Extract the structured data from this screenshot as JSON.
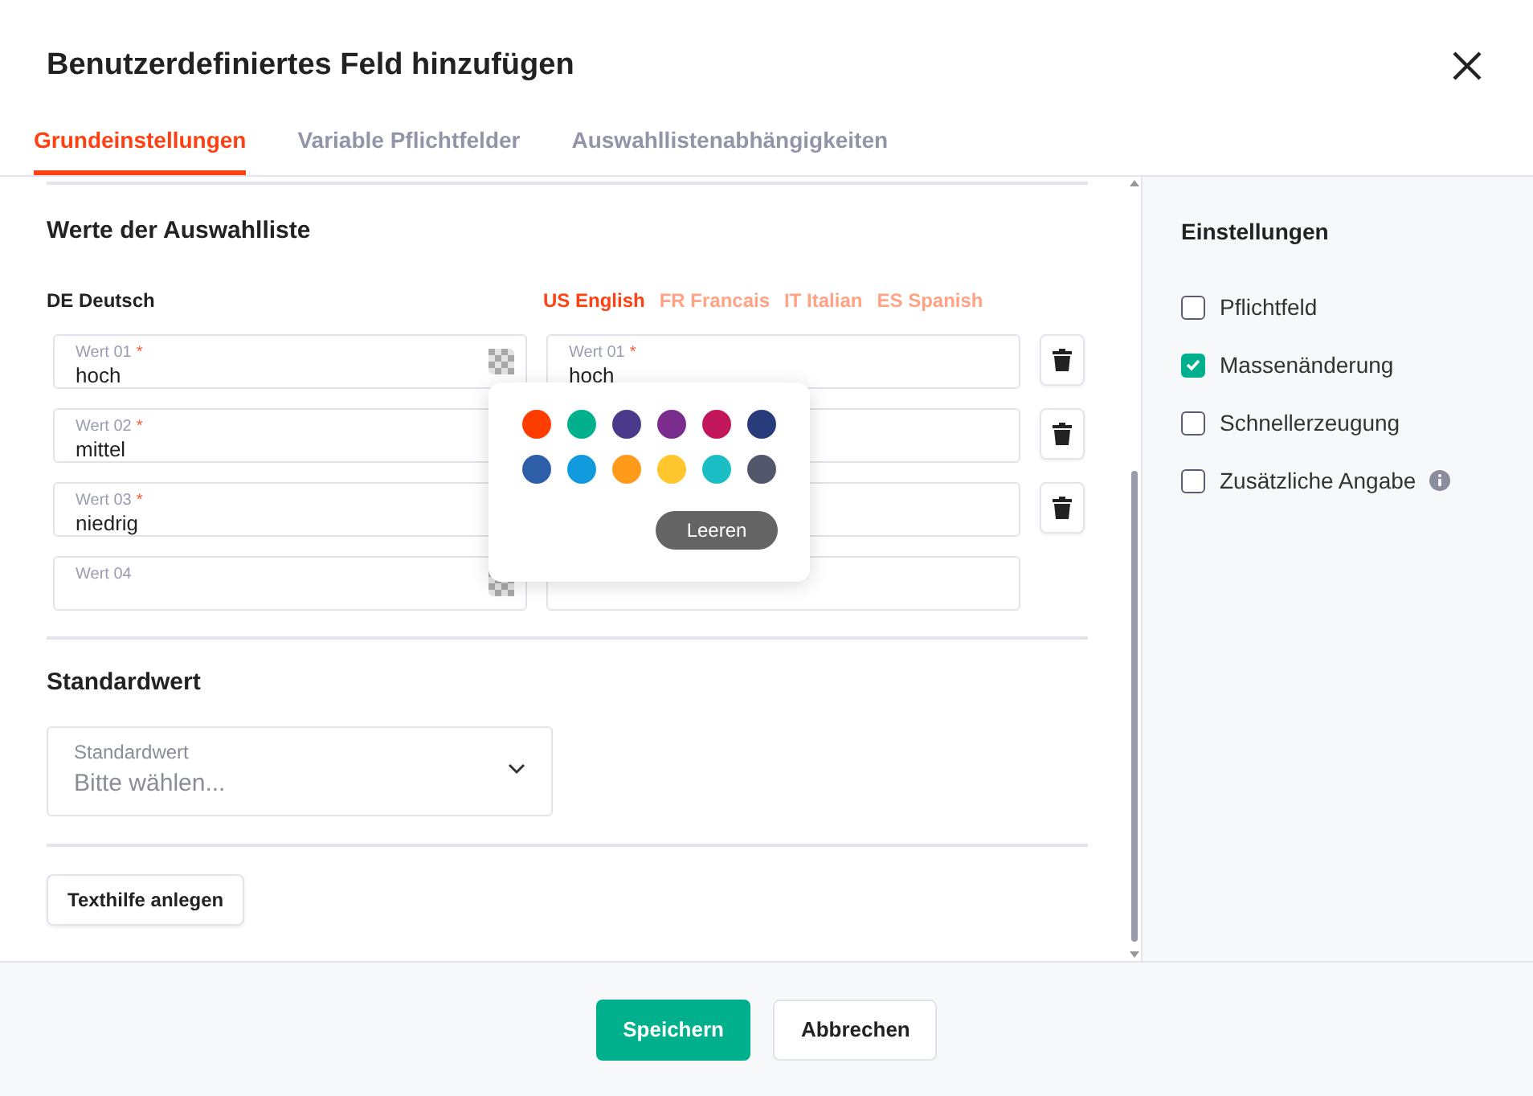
{
  "dialog": {
    "title": "Benutzerdefiniertes Feld hinzufügen"
  },
  "tabs": [
    {
      "label": "Grundeinstellungen",
      "selected": true
    },
    {
      "label": "Variable Pflichtfelder",
      "selected": false
    },
    {
      "label": "Auswahllistenabhängigkeiten",
      "selected": false
    }
  ],
  "values_section": {
    "heading": "Werte der Auswahlliste",
    "source_language": "DE Deutsch",
    "languages": [
      {
        "label": "US English",
        "selected": true
      },
      {
        "label": "FR Francais",
        "selected": false
      },
      {
        "label": "IT Italian",
        "selected": false
      },
      {
        "label": "ES Spanish",
        "selected": false
      }
    ],
    "source_fields": [
      {
        "label": "Wert 01",
        "required_mark": "*",
        "value": "hoch",
        "color_icon": true
      },
      {
        "label": "Wert 02",
        "required_mark": "*",
        "value": "mittel"
      },
      {
        "label": "Wert 03",
        "required_mark": "*",
        "value": "niedrig"
      },
      {
        "label": "Wert 04",
        "color_icon": true
      }
    ],
    "translation_fields": [
      {
        "label": "Wert 01",
        "required_mark": "*",
        "value": "hoch",
        "deletable": true
      },
      {
        "deletable": true
      },
      {
        "deletable": true
      },
      {
        "deletable": false
      }
    ]
  },
  "color_popover": {
    "colors": [
      {
        "color": "#ff3d00"
      },
      {
        "color": "#00b08c"
      },
      {
        "color": "#4b3a8c"
      },
      {
        "color": "#7b2d8e"
      },
      {
        "color": "#c2185b"
      },
      {
        "color": "#283b7a"
      },
      {
        "color": "#2d5fa8"
      },
      {
        "color": "#1199dd"
      },
      {
        "color": "#ff9a1a"
      },
      {
        "color": "#ffc62d"
      },
      {
        "color": "#1bbec4"
      },
      {
        "color": "#52566b"
      }
    ],
    "clear_button": "Leeren"
  },
  "default_section": {
    "heading": "Standardwert",
    "select": {
      "label": "Standardwert",
      "placeholder": "Bitte wählen..."
    }
  },
  "help_button": "Texthilfe anlegen",
  "settings": {
    "heading": "Einstellungen",
    "options": [
      {
        "label": "Pflichtfeld",
        "checked": false
      },
      {
        "label": "Massenänderung",
        "checked": true
      },
      {
        "label": "Schnellerzeugung",
        "checked": false
      },
      {
        "label": "Zusätzliche Angabe",
        "checked": false,
        "info": true
      }
    ]
  },
  "footer": {
    "save": "Speichern",
    "cancel": "Abbrechen"
  }
}
